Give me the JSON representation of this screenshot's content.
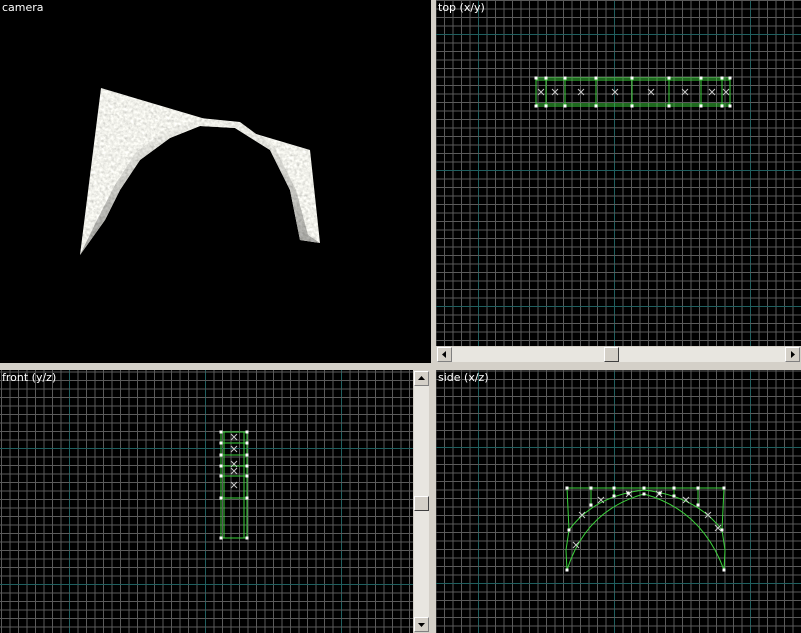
{
  "viewports": {
    "camera": {
      "label": "camera"
    },
    "top": {
      "label": "top (x/y)"
    },
    "front": {
      "label": "front (y/z)"
    },
    "side": {
      "label": "side (x/z)"
    }
  },
  "colors": {
    "grid_minor": "#5a5a5a",
    "grid_major": "#1f5f5f",
    "brush_outline": "#3cd23c",
    "vertex": "#ffffff",
    "center_marker": "#c8c8c8",
    "background": "#000000"
  },
  "icons": {
    "scroll_left": "arrow-left-icon",
    "scroll_right": "arrow-right-icon",
    "scroll_up": "arrow-up-icon",
    "scroll_down": "arrow-down-icon"
  }
}
